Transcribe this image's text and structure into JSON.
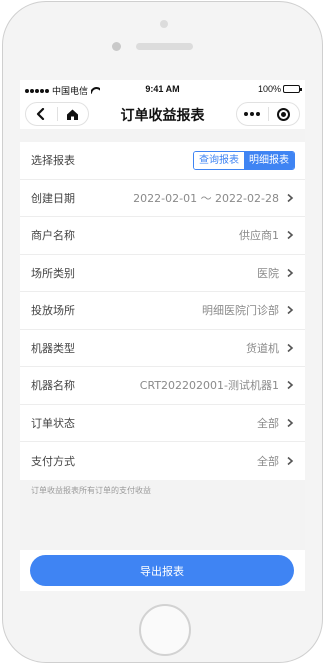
{
  "statusbar": {
    "carrier": "中国电信",
    "time": "9:41 AM",
    "battery": "100%"
  },
  "navbar": {
    "title": "订单收益报表"
  },
  "form": {
    "report_type": {
      "label": "选择报表",
      "options": [
        "查询报表",
        "明细报表"
      ],
      "selected": "明细报表"
    },
    "rows": [
      {
        "label": "创建日期",
        "value": "2022-02-01 ～ 2022-02-28"
      },
      {
        "label": "商户名称",
        "value": "供应商1"
      },
      {
        "label": "场所类别",
        "value": "医院"
      },
      {
        "label": "投放场所",
        "value": "明细医院门诊部"
      },
      {
        "label": "机器类型",
        "value": "货道机"
      },
      {
        "label": "机器名称",
        "value": "CRT202202001-测试机器1"
      },
      {
        "label": "订单状态",
        "value": "全部"
      },
      {
        "label": "支付方式",
        "value": "全部"
      }
    ]
  },
  "note": "订单收益报表所有订单的支付收益",
  "export_button": "导出报表",
  "colors": {
    "accent": "#3f84f3",
    "background": "#f3f3f3"
  }
}
